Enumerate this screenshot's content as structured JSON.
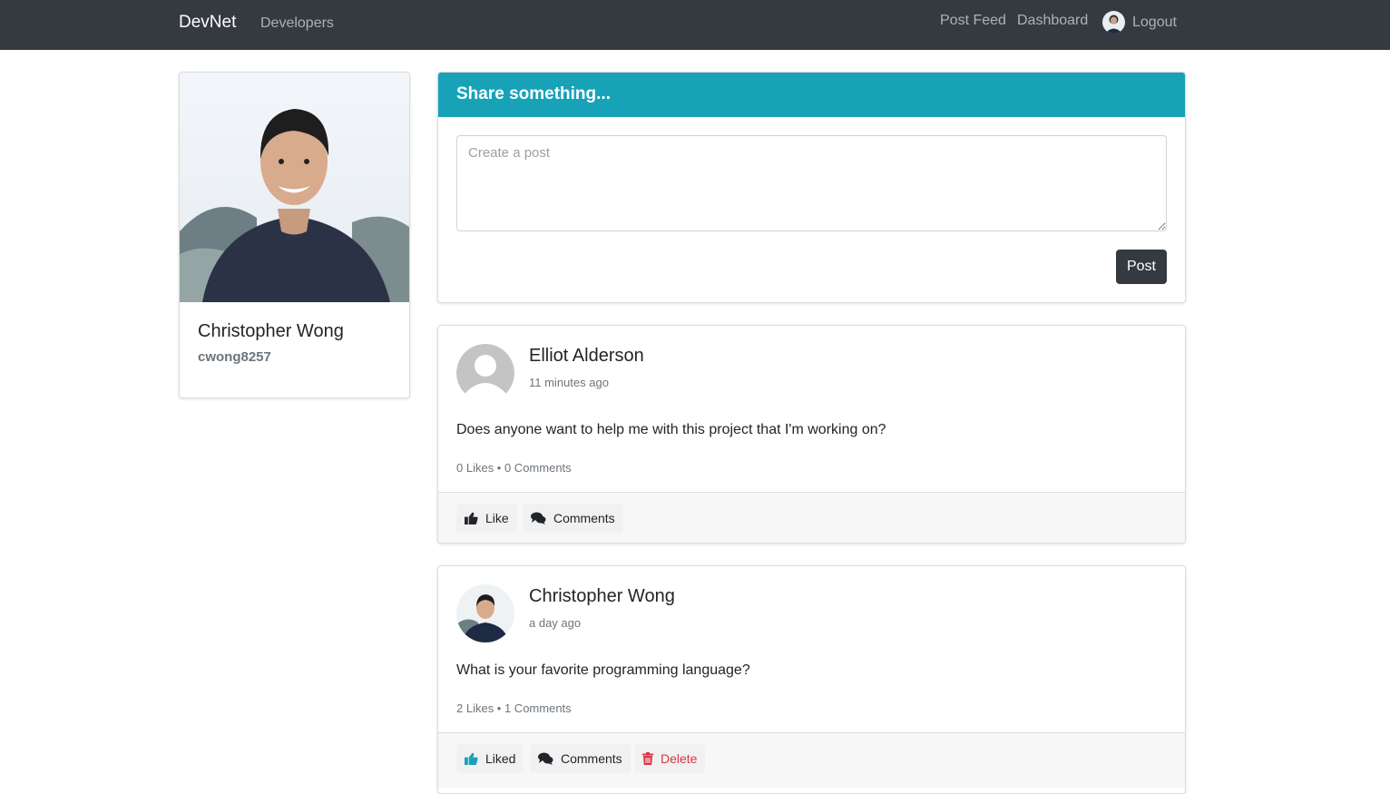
{
  "navbar": {
    "brand": "DevNet",
    "developers": "Developers",
    "post_feed": "Post Feed",
    "dashboard": "Dashboard",
    "logout": "Logout"
  },
  "profile": {
    "name": "Christopher Wong",
    "username": "cwong8257"
  },
  "share": {
    "title": "Share something...",
    "placeholder": "Create a post",
    "value": "",
    "post_label": "Post"
  },
  "posts": [
    {
      "author": "Elliot Alderson",
      "time": "11 minutes ago",
      "text": "Does anyone want to help me with this project that I'm working on?",
      "stats": "0 Likes • 0 Comments",
      "like_label": "Like",
      "comments_label": "Comments",
      "avatar": "default-user-avatar"
    },
    {
      "author": "Christopher Wong",
      "time": "a day ago",
      "text": "What is your favorite programming language?",
      "stats": "2 Likes • 1 Comments",
      "like_label": "Liked",
      "comments_label": "Comments",
      "delete_label": "Delete",
      "avatar": "user-photo-avatar"
    }
  ],
  "colors": {
    "navbar_bg": "#343a40",
    "share_header_bg": "#17a2b8",
    "liked_icon": "#17a2b8",
    "delete": "#dc3545",
    "post_button_bg": "#343a40"
  }
}
